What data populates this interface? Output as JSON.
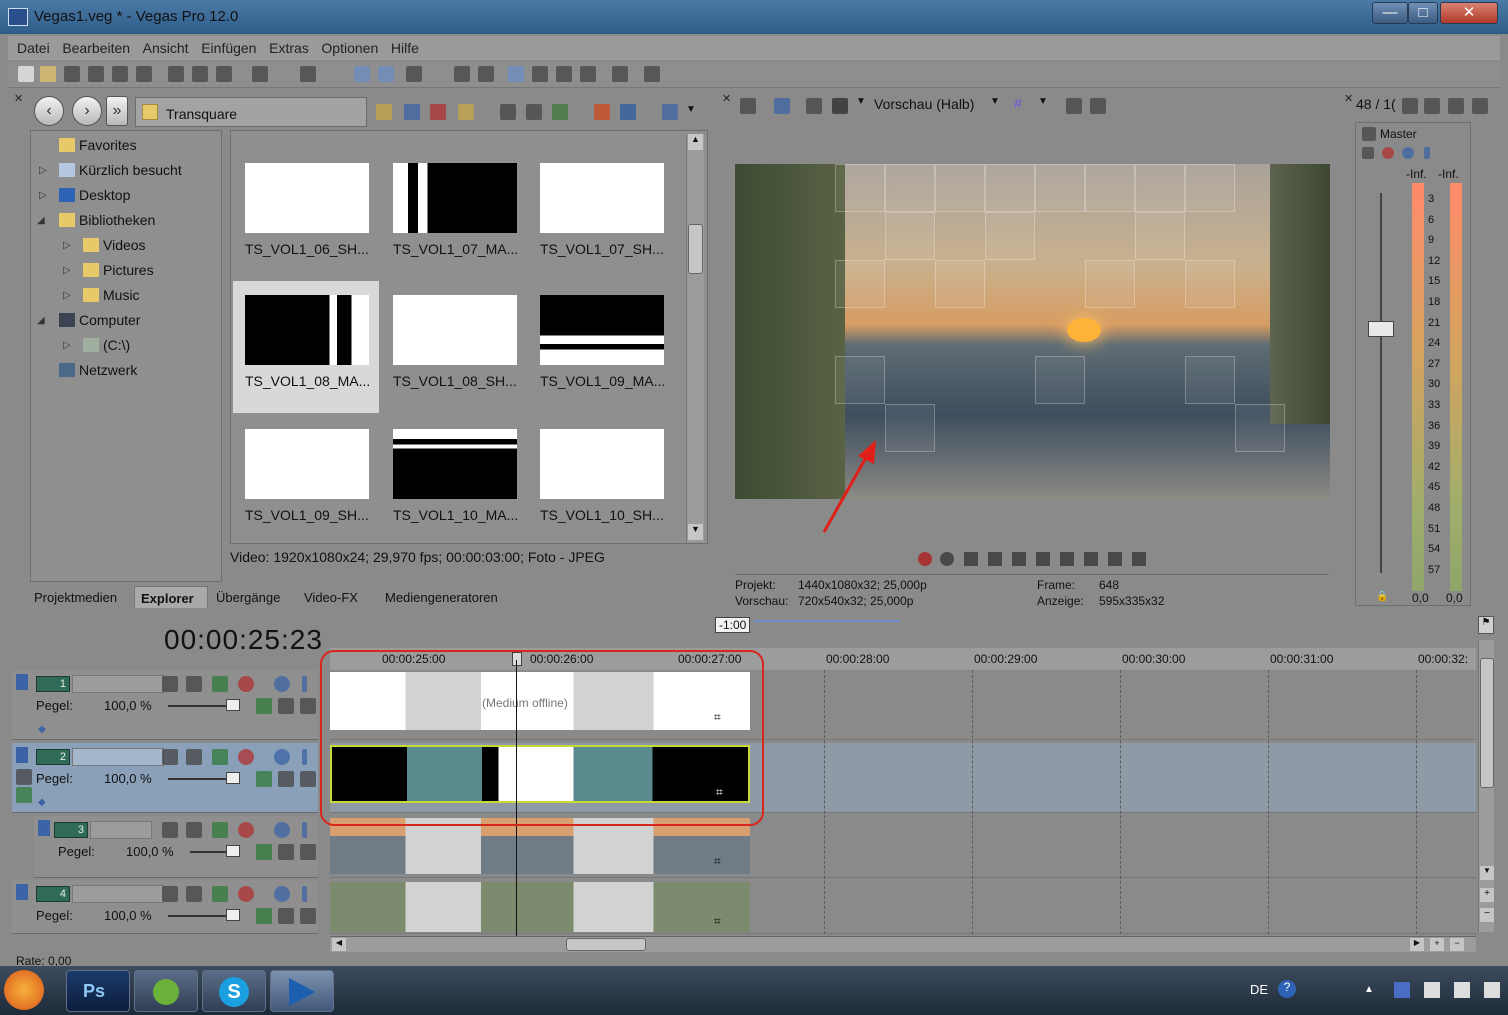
{
  "window": {
    "title": "Vegas1.veg * - Vegas Pro 12.0",
    "min": "—",
    "max": "□",
    "close": "✕"
  },
  "menu": [
    "Datei",
    "Bearbeiten",
    "Ansicht",
    "Einfügen",
    "Extras",
    "Optionen",
    "Hilfe"
  ],
  "explorer": {
    "path": "Transquare",
    "tree": [
      {
        "label": "Favorites",
        "icon": "star-folder-icon"
      },
      {
        "label": "Kürzlich besucht",
        "icon": "recent-icon"
      },
      {
        "label": "Desktop",
        "icon": "desktop-icon"
      },
      {
        "label": "Bibliotheken",
        "icon": "library-icon"
      },
      {
        "label": "Videos",
        "icon": "videos-folder-icon"
      },
      {
        "label": "Pictures",
        "icon": "pictures-folder-icon"
      },
      {
        "label": "Music",
        "icon": "music-folder-icon"
      },
      {
        "label": "Computer",
        "icon": "computer-icon"
      },
      {
        "label": "(C:\\)",
        "icon": "drive-icon"
      },
      {
        "label": "Netzwerk",
        "icon": "network-icon"
      }
    ],
    "thumbnails": [
      {
        "label": "TS_VOL1_06_SH...",
        "pattern": "white"
      },
      {
        "label": "TS_VOL1_07_MA...",
        "pattern": "black-left"
      },
      {
        "label": "TS_VOL1_07_SH...",
        "pattern": "white"
      },
      {
        "label": "TS_VOL1_08_MA...",
        "pattern": "black-right"
      },
      {
        "label": "TS_VOL1_08_SH...",
        "pattern": "white"
      },
      {
        "label": "TS_VOL1_09_MA...",
        "pattern": "black-top"
      },
      {
        "label": "TS_VOL1_09_SH...",
        "pattern": "white"
      },
      {
        "label": "TS_VOL1_10_MA...",
        "pattern": "black-bottom"
      },
      {
        "label": "TS_VOL1_10_SH...",
        "pattern": "white"
      }
    ],
    "video_info": "Video: 1920x1080x24; 29,970 fps; 00:00:03:00; Foto - JPEG",
    "tabs": [
      "Projektmedien",
      "Explorer",
      "Übergänge",
      "Video-FX",
      "Mediengeneratoren"
    ],
    "active_tab": "Explorer"
  },
  "preview": {
    "mode": "Vorschau (Halb)",
    "projekt_label": "Projekt:",
    "projekt_value": "1440x1080x32; 25,000p",
    "vorschau_label": "Vorschau:",
    "vorschau_value": "720x540x32; 25,000p",
    "frame_label": "Frame:",
    "frame_value": "648",
    "anzeige_label": "Anzeige:",
    "anzeige_value": "595x335x32"
  },
  "master": {
    "header": "48 / 1(",
    "label": "Master",
    "inf_left": "-Inf.",
    "inf_right": "-Inf.",
    "scale": [
      "3",
      "6",
      "9",
      "12",
      "15",
      "18",
      "21",
      "24",
      "27",
      "30",
      "33",
      "36",
      "39",
      "42",
      "45",
      "48",
      "51",
      "54",
      "57"
    ],
    "value_left": "0,0",
    "value_right": "0,0"
  },
  "timeline": {
    "timecode": "00:00:25:23",
    "loop_marker": "-1:00",
    "ruler": [
      "00:00:25:00",
      "00:00:26:00",
      "00:00:27:00",
      "00:00:28:00",
      "00:00:29:00",
      "00:00:30:00",
      "00:00:31:00",
      "00:00:32:"
    ],
    "tracks": [
      {
        "num": "1",
        "pegel_label": "Pegel:",
        "pegel_value": "100,0 %"
      },
      {
        "num": "2",
        "pegel_label": "Pegel:",
        "pegel_value": "100,0 %"
      },
      {
        "num": "3",
        "pegel_label": "Pegel:",
        "pegel_value": "100,0 %"
      },
      {
        "num": "4",
        "pegel_label": "Pegel:",
        "pegel_value": "100,0 %"
      }
    ],
    "offline_label": "(Medium offline)",
    "rate": "Rate: 0,00"
  },
  "taskbar": {
    "lang": "DE"
  },
  "colors": {
    "highlight_red": "#d9261c",
    "selected_track": "#8aa0b8",
    "event_teal": "#5b8a8e"
  }
}
